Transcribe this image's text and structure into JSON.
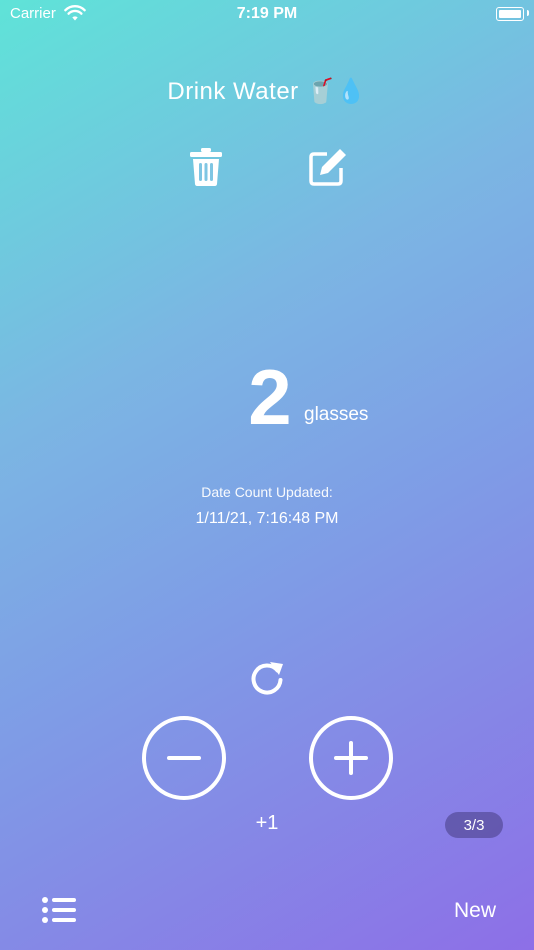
{
  "status_bar": {
    "carrier": "Carrier",
    "time": "7:19 PM"
  },
  "counter": {
    "title": "Drink Water 🥤💧",
    "count": "2",
    "unit": "glasses",
    "updated_label": "Date Count Updated:",
    "updated_value": "1/11/21, 7:16:48 PM",
    "step": "+1",
    "page_indicator": "3/3"
  },
  "toolbar": {
    "new_label": "New"
  },
  "icons": [
    "wifi-icon",
    "battery-icon",
    "trash-icon",
    "edit-icon",
    "reset-icon",
    "minus-icon",
    "plus-icon",
    "list-icon"
  ]
}
